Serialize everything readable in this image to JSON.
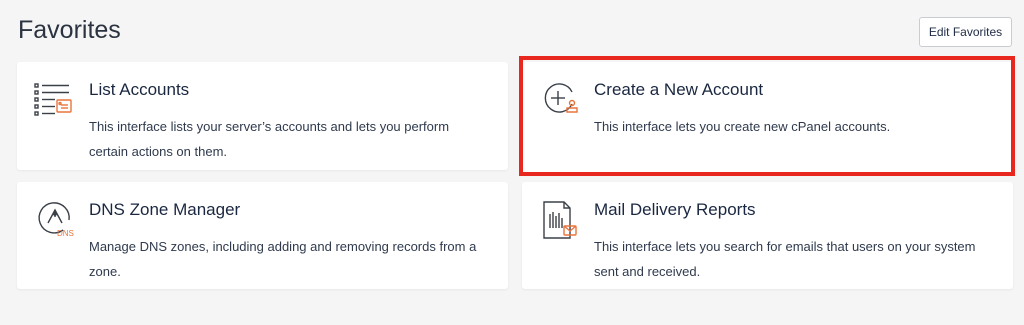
{
  "header": {
    "title": "Favorites",
    "edit_button_label": "Edit Favorites"
  },
  "cards": {
    "list_accounts": {
      "title": "List Accounts",
      "description": "This interface lists your server’s accounts and lets you perform certain actions on them.",
      "icon": "list-accounts-icon"
    },
    "create_account": {
      "title": "Create a New Account",
      "description": "This interface lets you create new cPanel accounts.",
      "icon": "create-account-icon"
    },
    "dns_zone": {
      "title": "DNS Zone Manager",
      "description": "Manage DNS zones, including adding and removing records from a zone.",
      "icon": "dns-zone-icon",
      "icon_text": "DNS"
    },
    "mail_delivery": {
      "title": "Mail Delivery Reports",
      "description": "This interface lets you search for emails that users on your system sent and received.",
      "icon": "mail-report-icon"
    }
  },
  "colors": {
    "accent": "#e8743b",
    "highlight": "#e8271e",
    "icon_stroke": "#3a4048"
  }
}
